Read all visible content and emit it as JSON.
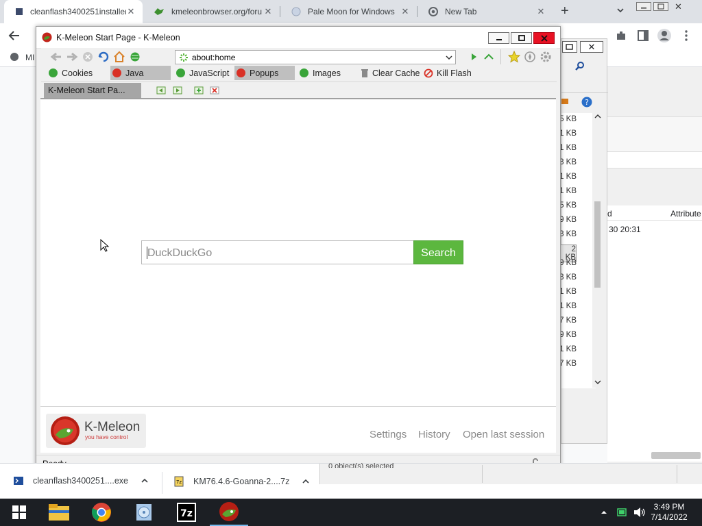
{
  "chrome": {
    "tabs": [
      {
        "label": "cleanflash3400251installer",
        "active": true,
        "icon": "document-icon"
      },
      {
        "label": "kmeleonbrowser.org/foru",
        "active": false,
        "icon": "kmeleon-icon"
      },
      {
        "label": "Pale Moon for Windows",
        "active": false,
        "icon": "globe-icon"
      },
      {
        "label": "New Tab",
        "active": false,
        "icon": "chrome-icon"
      }
    ],
    "new_tab_label": "+",
    "bookmark_label": "MI"
  },
  "explorer": {
    "sizes": [
      "5 KB",
      "1 KB",
      "1 KB",
      "3 KB",
      "1 KB",
      "1 KB",
      "5 KB",
      "9 KB",
      "3 KB",
      "2 KB",
      "9 KB",
      "3 KB",
      "1 KB",
      "1 KB",
      "7 KB",
      "9 KB",
      "1 KB",
      "7 KB"
    ],
    "selected_index": 9,
    "col_header_left": "d",
    "col_header_right": "Attribute",
    "date_cell": "30 20:31",
    "status": "0 object(s) selected"
  },
  "kmeleon": {
    "window_title": "K-Meleon Start Page - K-Meleon",
    "url": "about:home",
    "toggles": [
      {
        "label": "Cookies",
        "state": "on"
      },
      {
        "label": "Java",
        "state": "off"
      },
      {
        "label": "JavaScript",
        "state": "on"
      },
      {
        "label": "Popups",
        "state": "off"
      },
      {
        "label": "Images",
        "state": "on"
      },
      {
        "label": "Clear Cache",
        "state": "action"
      },
      {
        "label": "Kill Flash",
        "state": "action"
      }
    ],
    "tab_label": "K-Meleon Start Pa...",
    "search_placeholder": "DuckDuckGo",
    "search_button": "Search",
    "logo_text": "K-Meleon",
    "logo_tagline": "you have control",
    "footer_links": [
      "Settings",
      "History",
      "Open last session"
    ],
    "status_text": "Ready"
  },
  "downloads": [
    {
      "label": "cleanflash3400251....exe",
      "icon": "powershell-icon"
    },
    {
      "label": "KM76.4.6-Goanna-2....7z",
      "icon": "archive-icon"
    }
  ],
  "taskbar": {
    "apps": [
      "windows-start-icon",
      "file-explorer-icon",
      "chrome-icon",
      "media-player-icon",
      "7zip-icon",
      "kmeleon-icon"
    ],
    "time": "3:49 PM",
    "date": "7/14/2022"
  }
}
